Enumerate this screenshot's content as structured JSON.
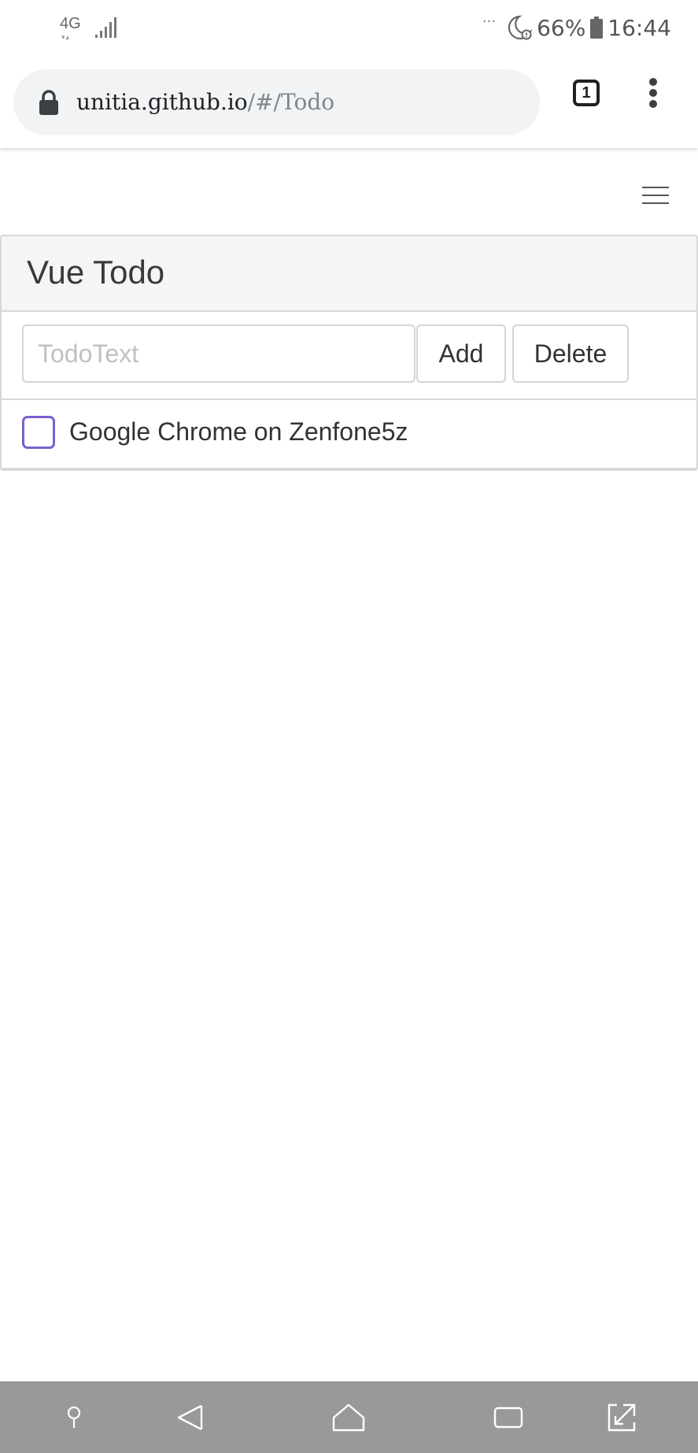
{
  "status_bar": {
    "network_type": "4G",
    "network_arrows": "▾▴",
    "overflow": "···",
    "battery_percent": "66%",
    "time": "16:44"
  },
  "browser": {
    "url_host": "unitia.github.io",
    "url_path": "/#/Todo",
    "tab_count": "1"
  },
  "app": {
    "title": "Vue Todo",
    "input": {
      "value": "",
      "placeholder": "TodoText"
    },
    "add_label": "Add",
    "delete_label": "Delete",
    "todos": [
      {
        "text": "Google Chrome on Zenfone5z",
        "checked": false
      }
    ]
  },
  "colors": {
    "checkbox_border": "#7b5fd1",
    "nav_bar_bg": "#999999",
    "card_header_bg": "#f5f5f5"
  }
}
